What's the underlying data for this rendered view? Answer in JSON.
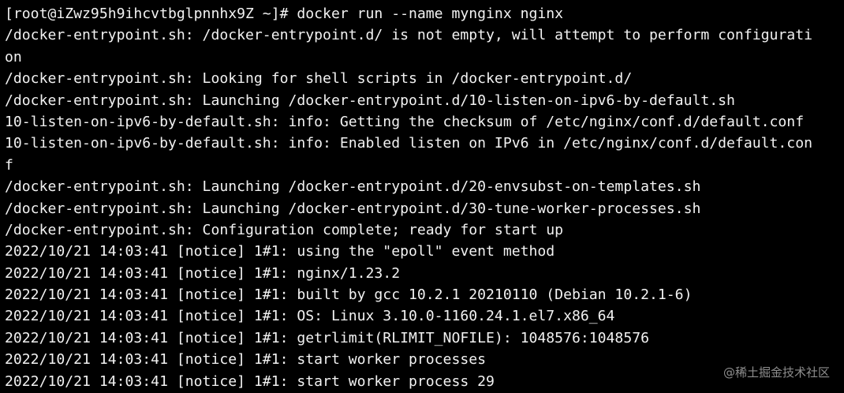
{
  "terminal": {
    "lines": [
      "[root@iZwz95h9ihcvtbglpnnhx9Z ~]# docker run --name mynginx nginx",
      "/docker-entrypoint.sh: /docker-entrypoint.d/ is not empty, will attempt to perform configurati",
      "on",
      "/docker-entrypoint.sh: Looking for shell scripts in /docker-entrypoint.d/",
      "/docker-entrypoint.sh: Launching /docker-entrypoint.d/10-listen-on-ipv6-by-default.sh",
      "10-listen-on-ipv6-by-default.sh: info: Getting the checksum of /etc/nginx/conf.d/default.conf",
      "10-listen-on-ipv6-by-default.sh: info: Enabled listen on IPv6 in /etc/nginx/conf.d/default.con",
      "f",
      "/docker-entrypoint.sh: Launching /docker-entrypoint.d/20-envsubst-on-templates.sh",
      "/docker-entrypoint.sh: Launching /docker-entrypoint.d/30-tune-worker-processes.sh",
      "/docker-entrypoint.sh: Configuration complete; ready for start up",
      "2022/10/21 14:03:41 [notice] 1#1: using the \"epoll\" event method",
      "2022/10/21 14:03:41 [notice] 1#1: nginx/1.23.2",
      "2022/10/21 14:03:41 [notice] 1#1: built by gcc 10.2.1 20210110 (Debian 10.2.1-6)",
      "2022/10/21 14:03:41 [notice] 1#1: OS: Linux 3.10.0-1160.24.1.el7.x86_64",
      "2022/10/21 14:03:41 [notice] 1#1: getrlimit(RLIMIT_NOFILE): 1048576:1048576",
      "2022/10/21 14:03:41 [notice] 1#1: start worker processes",
      "2022/10/21 14:03:41 [notice] 1#1: start worker process 29"
    ]
  },
  "watermark": {
    "text": "@稀土掘金技术社区"
  },
  "colors": {
    "background": "#000000",
    "text": "#f2f2f2"
  }
}
